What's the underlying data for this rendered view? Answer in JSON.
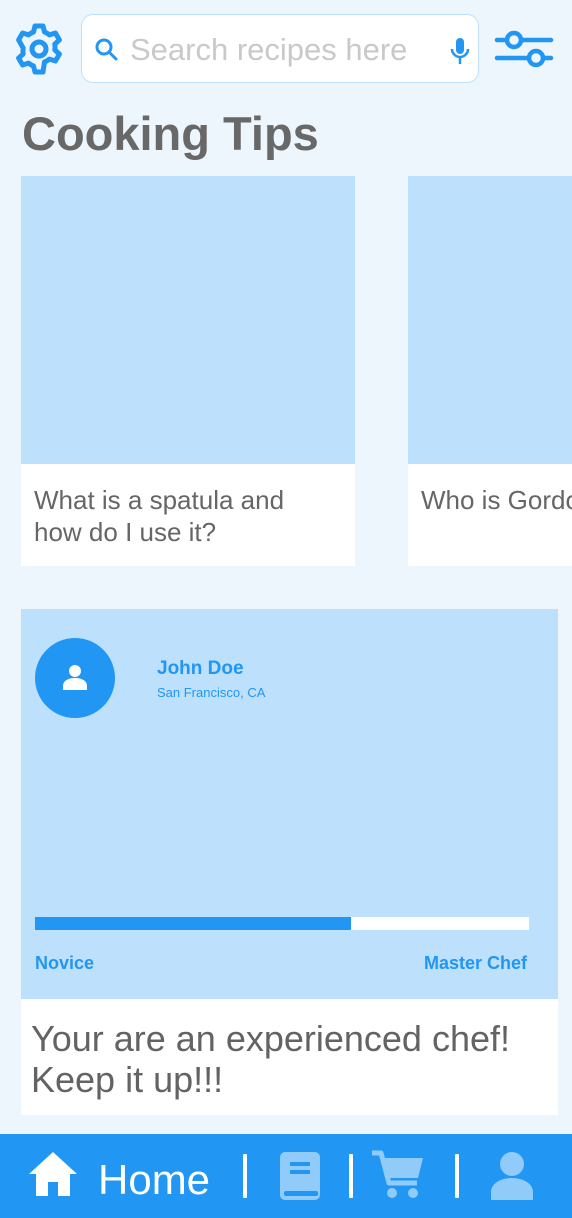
{
  "header": {
    "search_placeholder": "Search recipes here",
    "icons": [
      "gear-icon",
      "search-icon",
      "microphone-icon",
      "sliders-icon"
    ]
  },
  "section_title": "Cooking Tips",
  "tips": [
    {
      "caption": "What is a spatula and\nhow do I use it?"
    },
    {
      "caption": "Who is Gordon Ramsay?"
    }
  ],
  "profile": {
    "name": "John Doe",
    "location": "San Francisco, CA",
    "progress": 0.64,
    "level_min": "Novice",
    "level_max": "Master Chef",
    "message": "Your are an experienced chef!\nKeep it up!!!"
  },
  "nav": {
    "home_label": "Home",
    "icons": [
      "home-icon",
      "book-icon",
      "cart-icon",
      "user-icon"
    ]
  },
  "colors": {
    "accent": "#2196f3",
    "light_accent": "#bde0fc",
    "background": "#eef6fd",
    "text_gray": "#686868"
  }
}
